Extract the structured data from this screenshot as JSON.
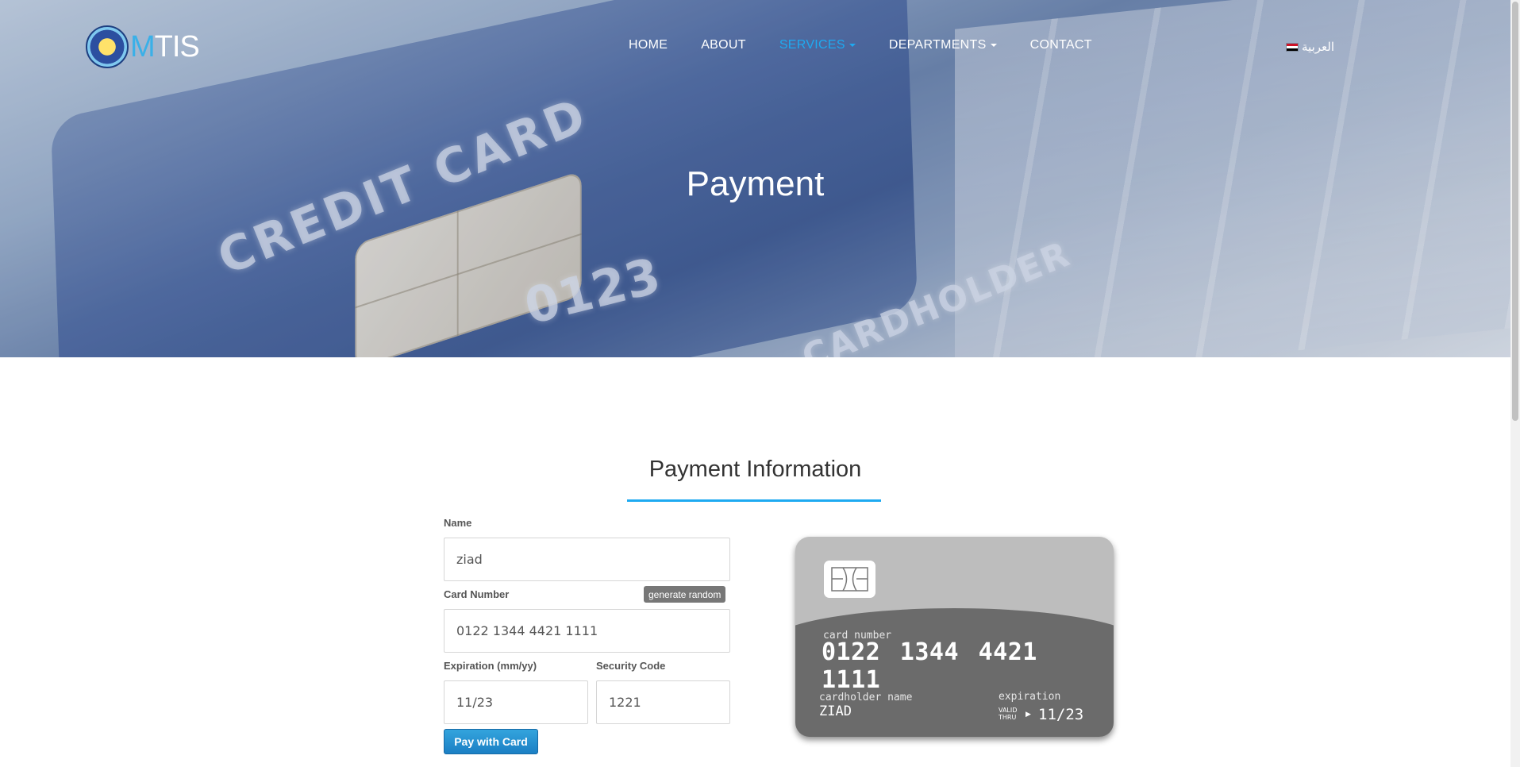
{
  "header": {
    "logo_text_m": "M",
    "logo_text_rest": "TIS",
    "nav": [
      {
        "label": "HOME"
      },
      {
        "label": "ABOUT"
      },
      {
        "label": "SERVICES"
      },
      {
        "label": "DEPARTMENTS"
      },
      {
        "label": "CONTACT"
      }
    ],
    "active_nav": "SERVICES",
    "language": "العربية"
  },
  "hero": {
    "title": "Payment",
    "background_text": [
      "CREDIT CARD",
      "0123",
      "CARDHOLDER"
    ]
  },
  "form": {
    "section_title": "Payment Information",
    "name_label": "Name",
    "name_value": "ziad",
    "card_number_label": "Card Number",
    "generate_label": "generate random",
    "card_number_value": "0122 1344 4421 1111",
    "expiration_label": "Expiration (mm/yy)",
    "expiration_value": "11/23",
    "security_label": "Security Code",
    "security_value": "1221",
    "pay_button": "Pay with Card"
  },
  "card_preview": {
    "card_number_caption": "card number",
    "card_number": "0122 1344 4421 1111",
    "holder_caption": "cardholder name",
    "holder_name": "ZIAD",
    "expiration_caption": "expiration",
    "valid_line1": "VALID",
    "valid_line2": "THRU",
    "expiration": "11/23"
  },
  "colors": {
    "accent": "#1eaaf1",
    "button": "#1b7fc4",
    "card_top": "#bdbdbd",
    "card_bottom": "#6b6b6b"
  }
}
